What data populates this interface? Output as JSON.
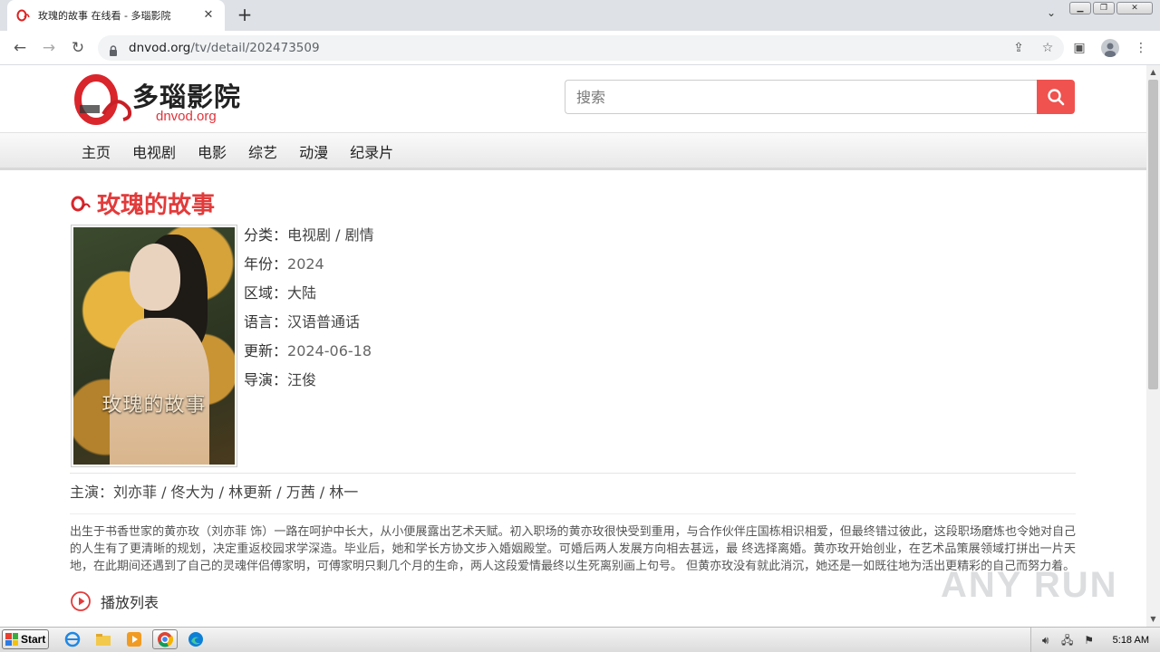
{
  "browser": {
    "tab_title": "玫瑰的故事 在线看 - 多瑙影院",
    "url_domain": "dnvod.org",
    "url_path": "/tv/detail/202473509"
  },
  "site": {
    "logo_text": "多瑙影院",
    "logo_sub": "dnvod.org",
    "search_placeholder": "搜索",
    "nav": [
      "主页",
      "电视剧",
      "电影",
      "综艺",
      "动漫",
      "纪录片"
    ]
  },
  "detail": {
    "title": "玫瑰的故事",
    "poster_title": "玫瑰的故事",
    "meta": [
      {
        "label": "分类：",
        "value": "电视剧 / 剧情"
      },
      {
        "label": "年份：",
        "value": "2024"
      },
      {
        "label": "区域：",
        "value": "大陆"
      },
      {
        "label": "语言：",
        "value": "汉语普通话"
      },
      {
        "label": "更新：",
        "value": "2024-06-18"
      },
      {
        "label": "导演：",
        "value": "汪俊"
      }
    ],
    "cast_label": "主演：",
    "cast": "刘亦菲 / 佟大为 / 林更新 / 万茜 / 林一",
    "description": "出生于书香世家的黄亦玫（刘亦菲 饰）一路在呵护中长大，从小便展露出艺术天赋。初入职场的黄亦玫很快受到重用，与合作伙伴庄国栋相识相爱，但最终错过彼此，这段职场磨炼也令她对自己的人生有了更清晰的规划，决定重返校园求学深造。毕业后，她和学长方协文步入婚姻殿堂。可婚后两人发展方向相去甚远，最 终选择离婚。黄亦玫开始创业，在艺术品策展领域打拼出一片天地，在此期间还遇到了自己的灵魂伴侣傅家明，可傅家明只剩几个月的生命，两人这段爱情最终以生死离别画上句号。 但黄亦玫没有就此消沉，她还是一如既往地为活出更精彩的自己而努力着。",
    "playlist_label": "播放列表"
  },
  "watermark": "ANY RUN",
  "taskbar": {
    "start_label": "Start",
    "clock": "5:18 AM"
  },
  "colors": {
    "accent": "#e23b3b",
    "search_button": "#f0524f"
  }
}
